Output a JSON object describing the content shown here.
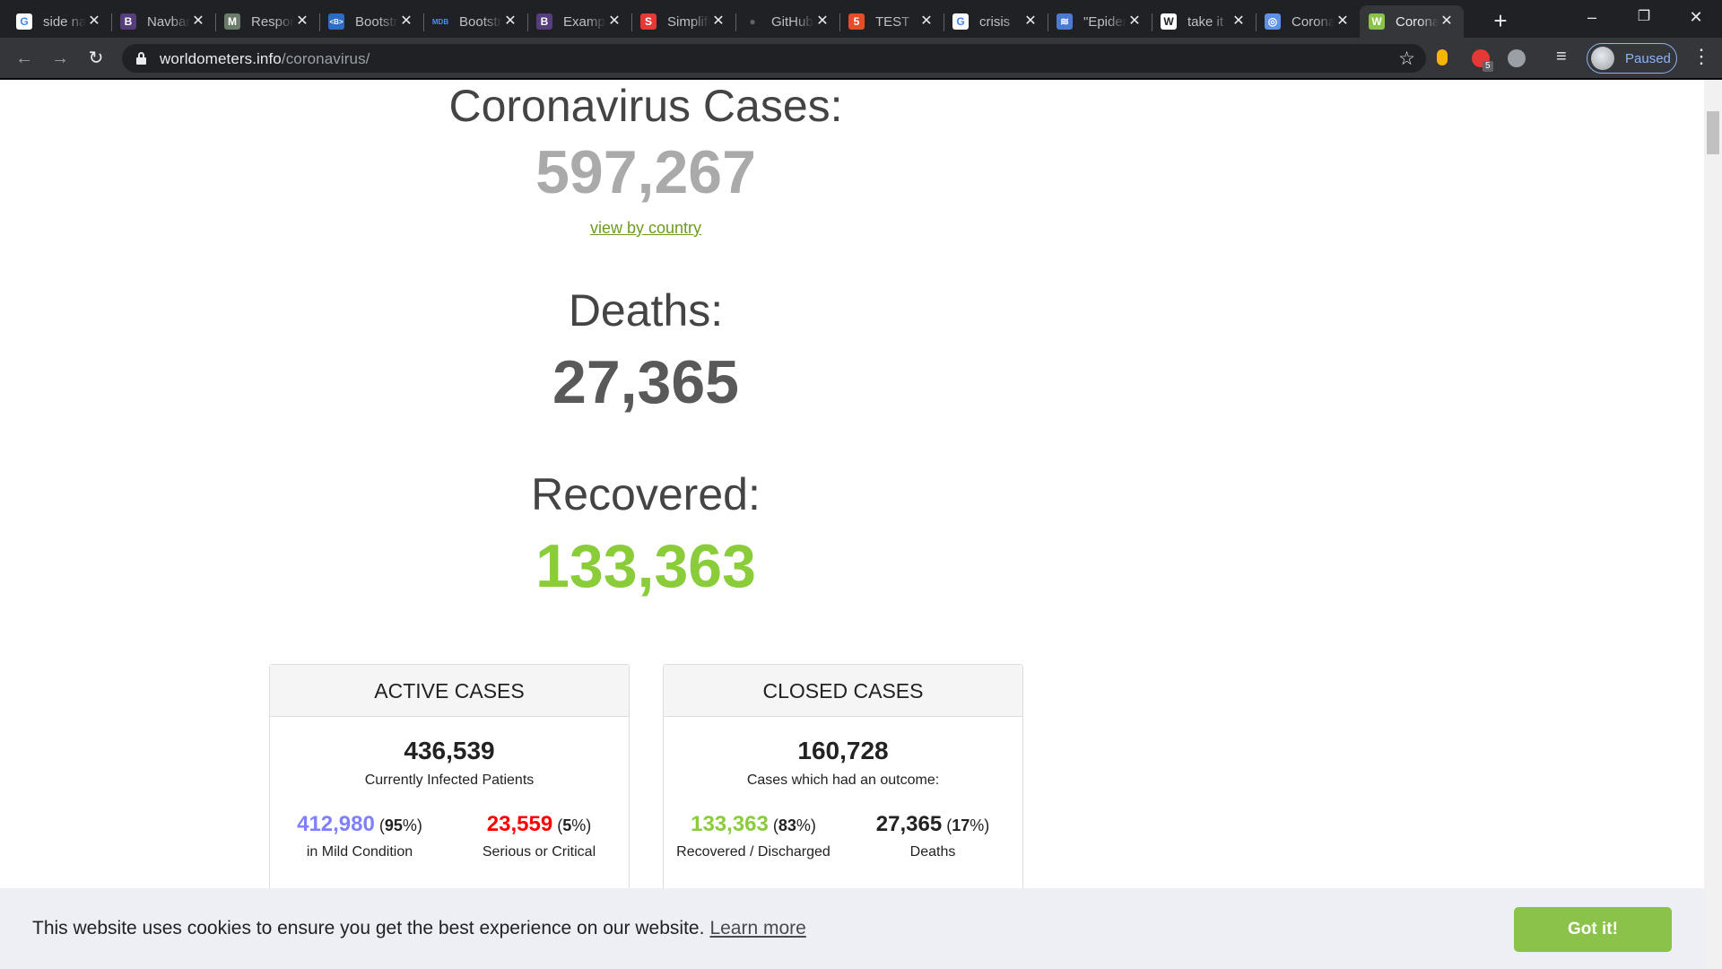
{
  "tabs": [
    {
      "title": "side navbar",
      "icon": "google-icon",
      "color": "#ffffff",
      "glyph": "G",
      "glyph_color": "#4285f4"
    },
    {
      "title": "Navbar",
      "icon": "bootstrap-icon",
      "color": "#563d7c",
      "glyph": "B",
      "glyph_color": "#ffffff"
    },
    {
      "title": "Responsive",
      "icon": "mk-icon",
      "color": "#6b7b6b",
      "glyph": "M",
      "glyph_color": "#ffffff"
    },
    {
      "title": "Bootstrap",
      "icon": "bootstrap-studio-icon",
      "color": "#2b6cc4",
      "glyph": "<B>",
      "glyph_color": "#ffffff"
    },
    {
      "title": "Bootstrap",
      "icon": "mdb-icon",
      "color": "#202124",
      "glyph": "MDB",
      "glyph_color": "#4f8df5"
    },
    {
      "title": "Examples",
      "icon": "bootstrap-icon",
      "color": "#563d7c",
      "glyph": "B",
      "glyph_color": "#ffffff"
    },
    {
      "title": "Simplified",
      "icon": "simplified-icon",
      "color": "#e53935",
      "glyph": "S",
      "glyph_color": "#ffffff"
    },
    {
      "title": "GitHub",
      "icon": "github-icon",
      "color": "#202124",
      "glyph": "●",
      "glyph_color": "#5f6368"
    },
    {
      "title": "TEST",
      "icon": "html5-icon",
      "color": "#e44d26",
      "glyph": "5",
      "glyph_color": "#ffffff"
    },
    {
      "title": "crisis",
      "icon": "google-icon",
      "color": "#ffffff",
      "glyph": "G",
      "glyph_color": "#4285f4"
    },
    {
      "title": "\"Epidemic",
      "icon": "bird-icon",
      "color": "#4a7bd0",
      "glyph": "≋",
      "glyph_color": "#ffffff"
    },
    {
      "title": "take it",
      "icon": "wikipedia-icon",
      "color": "#ffffff",
      "glyph": "W",
      "glyph_color": "#202124"
    },
    {
      "title": "Coronavirus",
      "icon": "who-icon",
      "color": "#5b92e5",
      "glyph": "◎",
      "glyph_color": "#ffffff"
    },
    {
      "title": "Coronavirus",
      "icon": "worldometers-icon",
      "color": "#8bc34a",
      "glyph": "W",
      "glyph_color": "#ffffff"
    }
  ],
  "active_tab_index": 13,
  "url": {
    "host": "worldometers.info",
    "path": "/coronavirus/"
  },
  "profile": {
    "label": "Paused"
  },
  "extension_badge": "5",
  "counters": {
    "cases": {
      "title": "Coronavirus Cases:",
      "value": "597,267",
      "color": "#aaaaaa"
    },
    "view_by_country": "view by country",
    "deaths": {
      "title": "Deaths:",
      "value": "27,365",
      "color": "#595959"
    },
    "recovered": {
      "title": "Recovered:",
      "value": "133,363",
      "color": "#8acc3a"
    }
  },
  "active_cases": {
    "header": "ACTIVE CASES",
    "total": "436,539",
    "subtitle": "Currently Infected Patients",
    "mild": {
      "value": "412,980",
      "pct": "95",
      "label": "in Mild Condition",
      "color": "#8080ff"
    },
    "serious": {
      "value": "23,559",
      "pct": "5",
      "label": "Serious or Critical",
      "color": "#ff0000"
    }
  },
  "closed_cases": {
    "header": "CLOSED CASES",
    "total": "160,728",
    "subtitle": "Cases which had an outcome:",
    "recovered": {
      "value": "133,363",
      "pct": "83",
      "label": "Recovered / Discharged",
      "color": "#8acc3a"
    },
    "deaths": {
      "value": "27,365",
      "pct": "17",
      "label": "Deaths",
      "color": "#222222"
    }
  },
  "cookie": {
    "message": "This website uses cookies to ensure you get the best experience on our website.",
    "link": "Learn more",
    "button": "Got it!"
  }
}
